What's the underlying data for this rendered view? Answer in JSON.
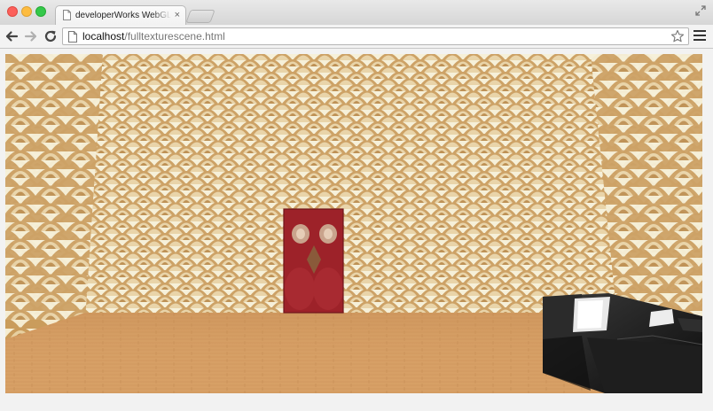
{
  "tab": {
    "title": "developerWorks WebGL Th",
    "close_glyph": "×"
  },
  "address": {
    "host": "localhost",
    "path": "/fulltexturescene.html"
  },
  "icons": {
    "back": "arrow-left-icon",
    "forward": "arrow-right-icon",
    "reload": "reload-icon",
    "star": "star-icon",
    "menu": "hamburger-menu-icon",
    "page": "page-icon",
    "fullscreen": "fullscreen-icon"
  },
  "colors": {
    "wall": "#f6efd6",
    "wall_motif": "#c99b5a",
    "floor": "#d7a066",
    "door": "#9d2229",
    "sofa": "#171717"
  }
}
